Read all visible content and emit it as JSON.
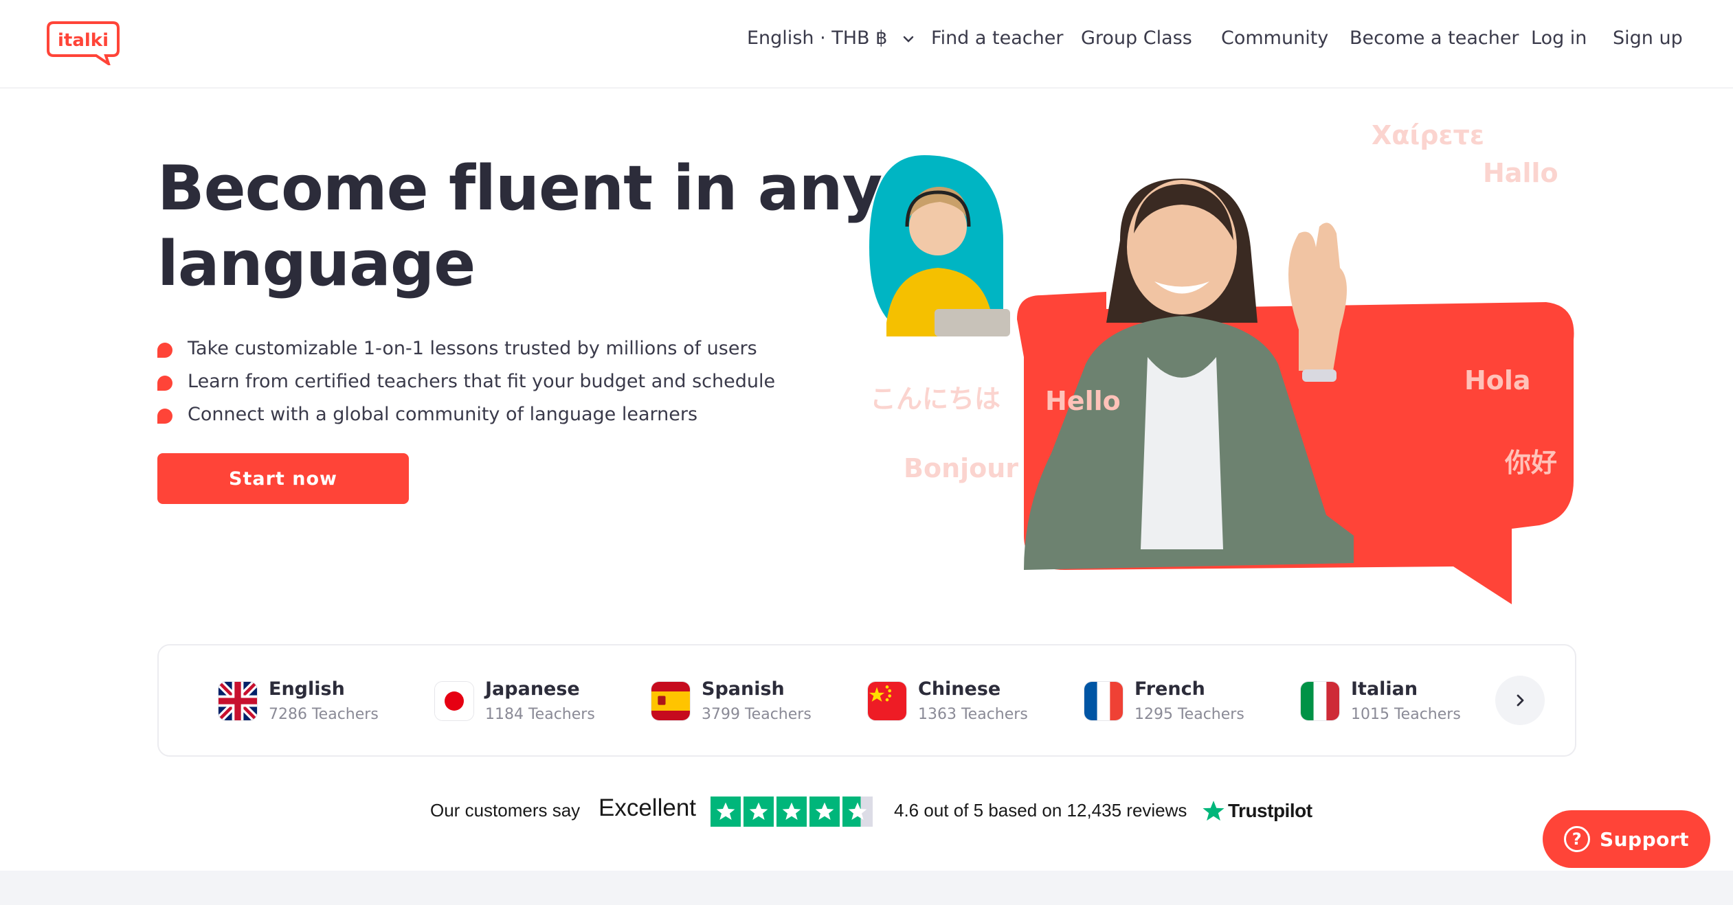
{
  "header": {
    "logo_text": "italki",
    "locale_label": "English · THB ฿",
    "nav": {
      "find_teacher": "Find a teacher",
      "group_class": "Group Class",
      "community": "Community",
      "become_teacher": "Become a teacher",
      "login": "Log in",
      "signup": "Sign up"
    }
  },
  "hero": {
    "title_line1": "Become fluent in any",
    "title_line2": "language",
    "bullets": [
      "Take customizable 1-on-1 lessons trusted by millions of users",
      "Learn from certified teachers that fit your budget and schedule",
      "Connect with a global community of language learners"
    ],
    "cta_label": "Start now",
    "greetings": [
      "Χαίρετε",
      "Hallo",
      "こんにちは",
      "Hello",
      "Hola",
      "Bonjour",
      "你好"
    ]
  },
  "languages": {
    "items": [
      {
        "name": "English",
        "count": "7286 Teachers",
        "flag": "uk-flag"
      },
      {
        "name": "Japanese",
        "count": "1184 Teachers",
        "flag": "japan-flag"
      },
      {
        "name": "Spanish",
        "count": "3799 Teachers",
        "flag": "spain-flag"
      },
      {
        "name": "Chinese",
        "count": "1363 Teachers",
        "flag": "china-flag"
      },
      {
        "name": "French",
        "count": "1295 Teachers",
        "flag": "france-flag"
      },
      {
        "name": "Italian",
        "count": "1015 Teachers",
        "flag": "italy-flag"
      }
    ],
    "next_icon": "chevron-right-icon"
  },
  "trustpilot": {
    "our_customers_say": "Our customers say",
    "rating_word": "Excellent",
    "rating_text": "4.6 out of 5 based on 12,435 reviews",
    "brand": "Trustpilot",
    "stars": 4.6
  },
  "support": {
    "label": "Support",
    "icon": "question-icon"
  },
  "colors": {
    "brand_red": "#ff4438",
    "trustpilot_green": "#00b67a",
    "text_dark": "#2c2c3a"
  }
}
